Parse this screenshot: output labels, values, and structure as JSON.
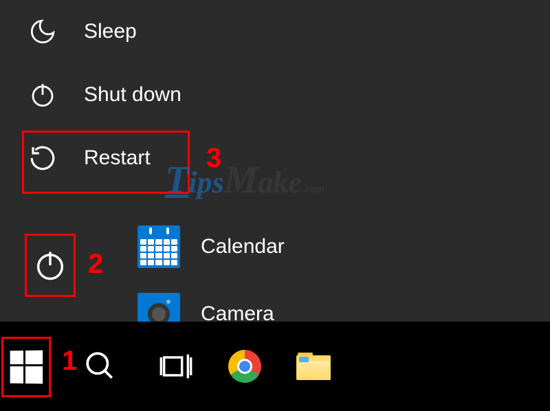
{
  "power_menu": {
    "sleep": "Sleep",
    "shutdown": "Shut down",
    "restart": "Restart"
  },
  "apps": {
    "calendar": "Calendar",
    "camera": "Camera"
  },
  "annotations": {
    "a1": "1",
    "a2": "2",
    "a3": "3"
  },
  "watermark": {
    "t": "T",
    "ips": "ips",
    "m": "M",
    "ake": "ake",
    "com": ".com"
  }
}
